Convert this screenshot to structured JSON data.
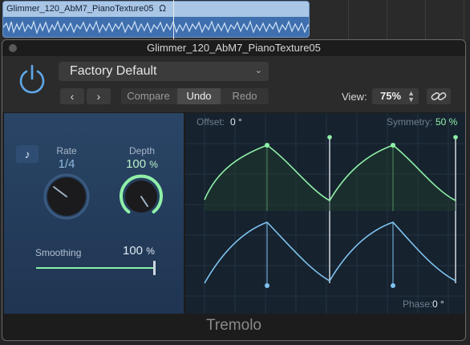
{
  "track": {
    "clip_name": "Glimmer_120_AbM7_PianoTexture05",
    "loop_glyph": "ᘯ"
  },
  "window": {
    "title": "Glimmer_120_AbM7_PianoTexture05"
  },
  "header": {
    "preset": "Factory Default",
    "prev_symbol": "‹",
    "next_symbol": "›",
    "compare_label": "Compare",
    "undo_label": "Undo",
    "redo_label": "Redo",
    "view_label": "View:",
    "view_value": "75%",
    "power_icon": "power-icon",
    "link_icon": "link-icon"
  },
  "controls": {
    "note_symbol": "♪",
    "rate": {
      "label": "Rate",
      "value": "1/4"
    },
    "depth": {
      "label": "Depth",
      "value": "100",
      "unit": "%"
    },
    "smoothing": {
      "label": "Smoothing",
      "value": "100",
      "unit": "%"
    }
  },
  "graph": {
    "offset_label": "Offset:",
    "offset_value": "0 °",
    "symmetry_label": "Symmetry:",
    "symmetry_value": "50 %",
    "phase_label": "Phase:",
    "phase_value": "0 °"
  },
  "plugin_name": "Tremolo",
  "colors": {
    "accent_green": "#8ff0a8",
    "accent_blue": "#7fc3f0",
    "panel_blue": "#2a4566",
    "power_blue": "#5ea8e8"
  }
}
